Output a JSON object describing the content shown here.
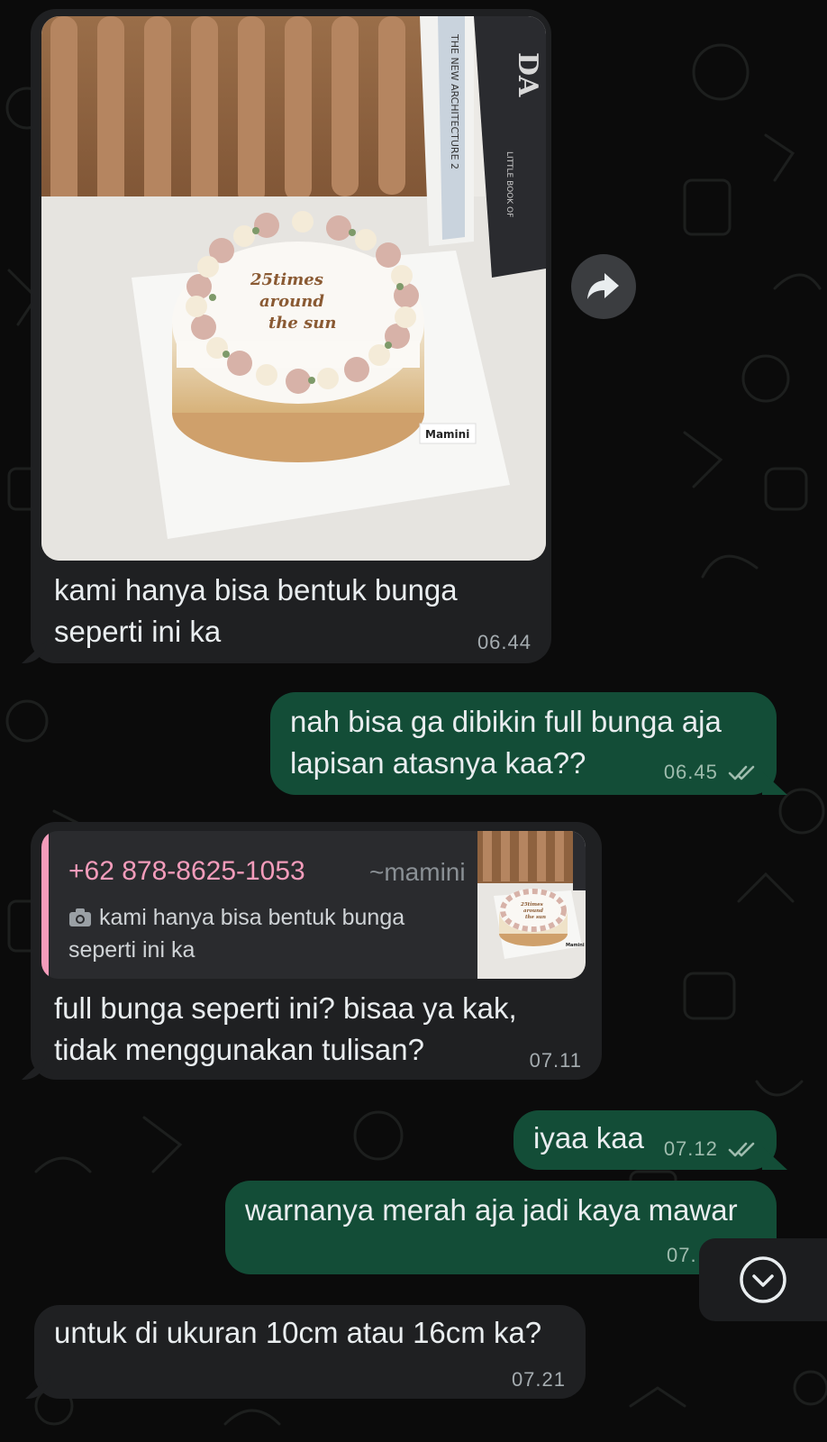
{
  "photo": {
    "cake_text": [
      "25times",
      "around",
      "the sun"
    ],
    "brand_tag": "Mamini",
    "book_spines": [
      "THE NEW ARCHITECTURE 2",
      "LITTLE BOOK OF",
      "DA"
    ]
  },
  "messages": [
    {
      "id": "m1",
      "direction": "incoming",
      "type": "image",
      "text": "kami hanya bisa bentuk bunga\nseperti ini ka",
      "time": "06.44"
    },
    {
      "id": "m2",
      "direction": "outgoing",
      "text": "nah bisa ga dibikin full bunga aja\nlapisan atasnya kaa??",
      "time": "06.45",
      "status": "read"
    },
    {
      "id": "m3",
      "direction": "incoming",
      "type": "reply",
      "quote": {
        "phone": "+62 878-8625-1053",
        "push_name": "~mamini",
        "text_line1": "kami hanya bisa bentuk bunga",
        "text_line2": "seperti ini ka",
        "thumb_cake_text": [
          "25times",
          "around",
          "the sun"
        ],
        "thumb_brand": "Mamini"
      },
      "text": "full bunga seperti ini? bisaa ya kak,\ntidak menggunakan tulisan?",
      "time": "07.11"
    },
    {
      "id": "m4",
      "direction": "outgoing",
      "text": "iyaa kaa",
      "time": "07.12",
      "status": "read"
    },
    {
      "id": "m5",
      "direction": "outgoing",
      "text": "warnanya merah aja jadi kaya mawar",
      "time": "07.",
      "status": "read"
    },
    {
      "id": "m6",
      "direction": "incoming",
      "text": "untuk di ukuran 10cm atau 16cm ka?",
      "time": "07.21"
    }
  ],
  "icons": {
    "forward": "forward-arrow-icon",
    "scroll_down": "chevron-down-circle-icon",
    "read_receipt": "double-check-icon",
    "camera": "camera-icon"
  },
  "colors": {
    "background": "#0b0b0b",
    "incoming_bubble": "#1f2022",
    "outgoing_bubble": "#134d37",
    "quote_accent": "#f49cbb",
    "read_ticks": "#9fbcae"
  }
}
